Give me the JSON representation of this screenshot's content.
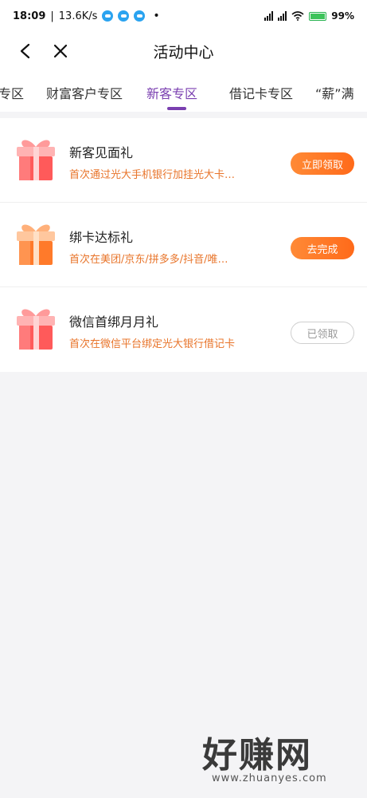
{
  "status_bar": {
    "time": "18:09",
    "net_speed": "13.6K/s",
    "bullet": "•",
    "battery": "99%"
  },
  "header": {
    "title": "活动中心"
  },
  "tabs": [
    {
      "label": "专区",
      "active": false
    },
    {
      "label": "财富客户专区",
      "active": false
    },
    {
      "label": "新客专区",
      "active": true
    },
    {
      "label": "借记卡专区",
      "active": false
    },
    {
      "label": "“薪”满",
      "active": false
    }
  ],
  "activities": [
    {
      "title": "新客见面礼",
      "desc": "首次通过光大手机银行加挂光大卡…",
      "button": "立即领取",
      "state": "active"
    },
    {
      "title": "绑卡达标礼",
      "desc": "首次在美团/京东/拼多多/抖音/唯…",
      "button": "去完成",
      "state": "active"
    },
    {
      "title": "微信首绑月月礼",
      "desc": "首次在微信平台绑定光大银行借记卡",
      "button": "已领取",
      "state": "done"
    }
  ],
  "watermark": {
    "main": "好赚网",
    "url": "www.zhuanyes.com"
  },
  "colors": {
    "accent": "#7a3fb0",
    "button_orange": "#ff7a26",
    "desc_orange": "#e8742a"
  }
}
